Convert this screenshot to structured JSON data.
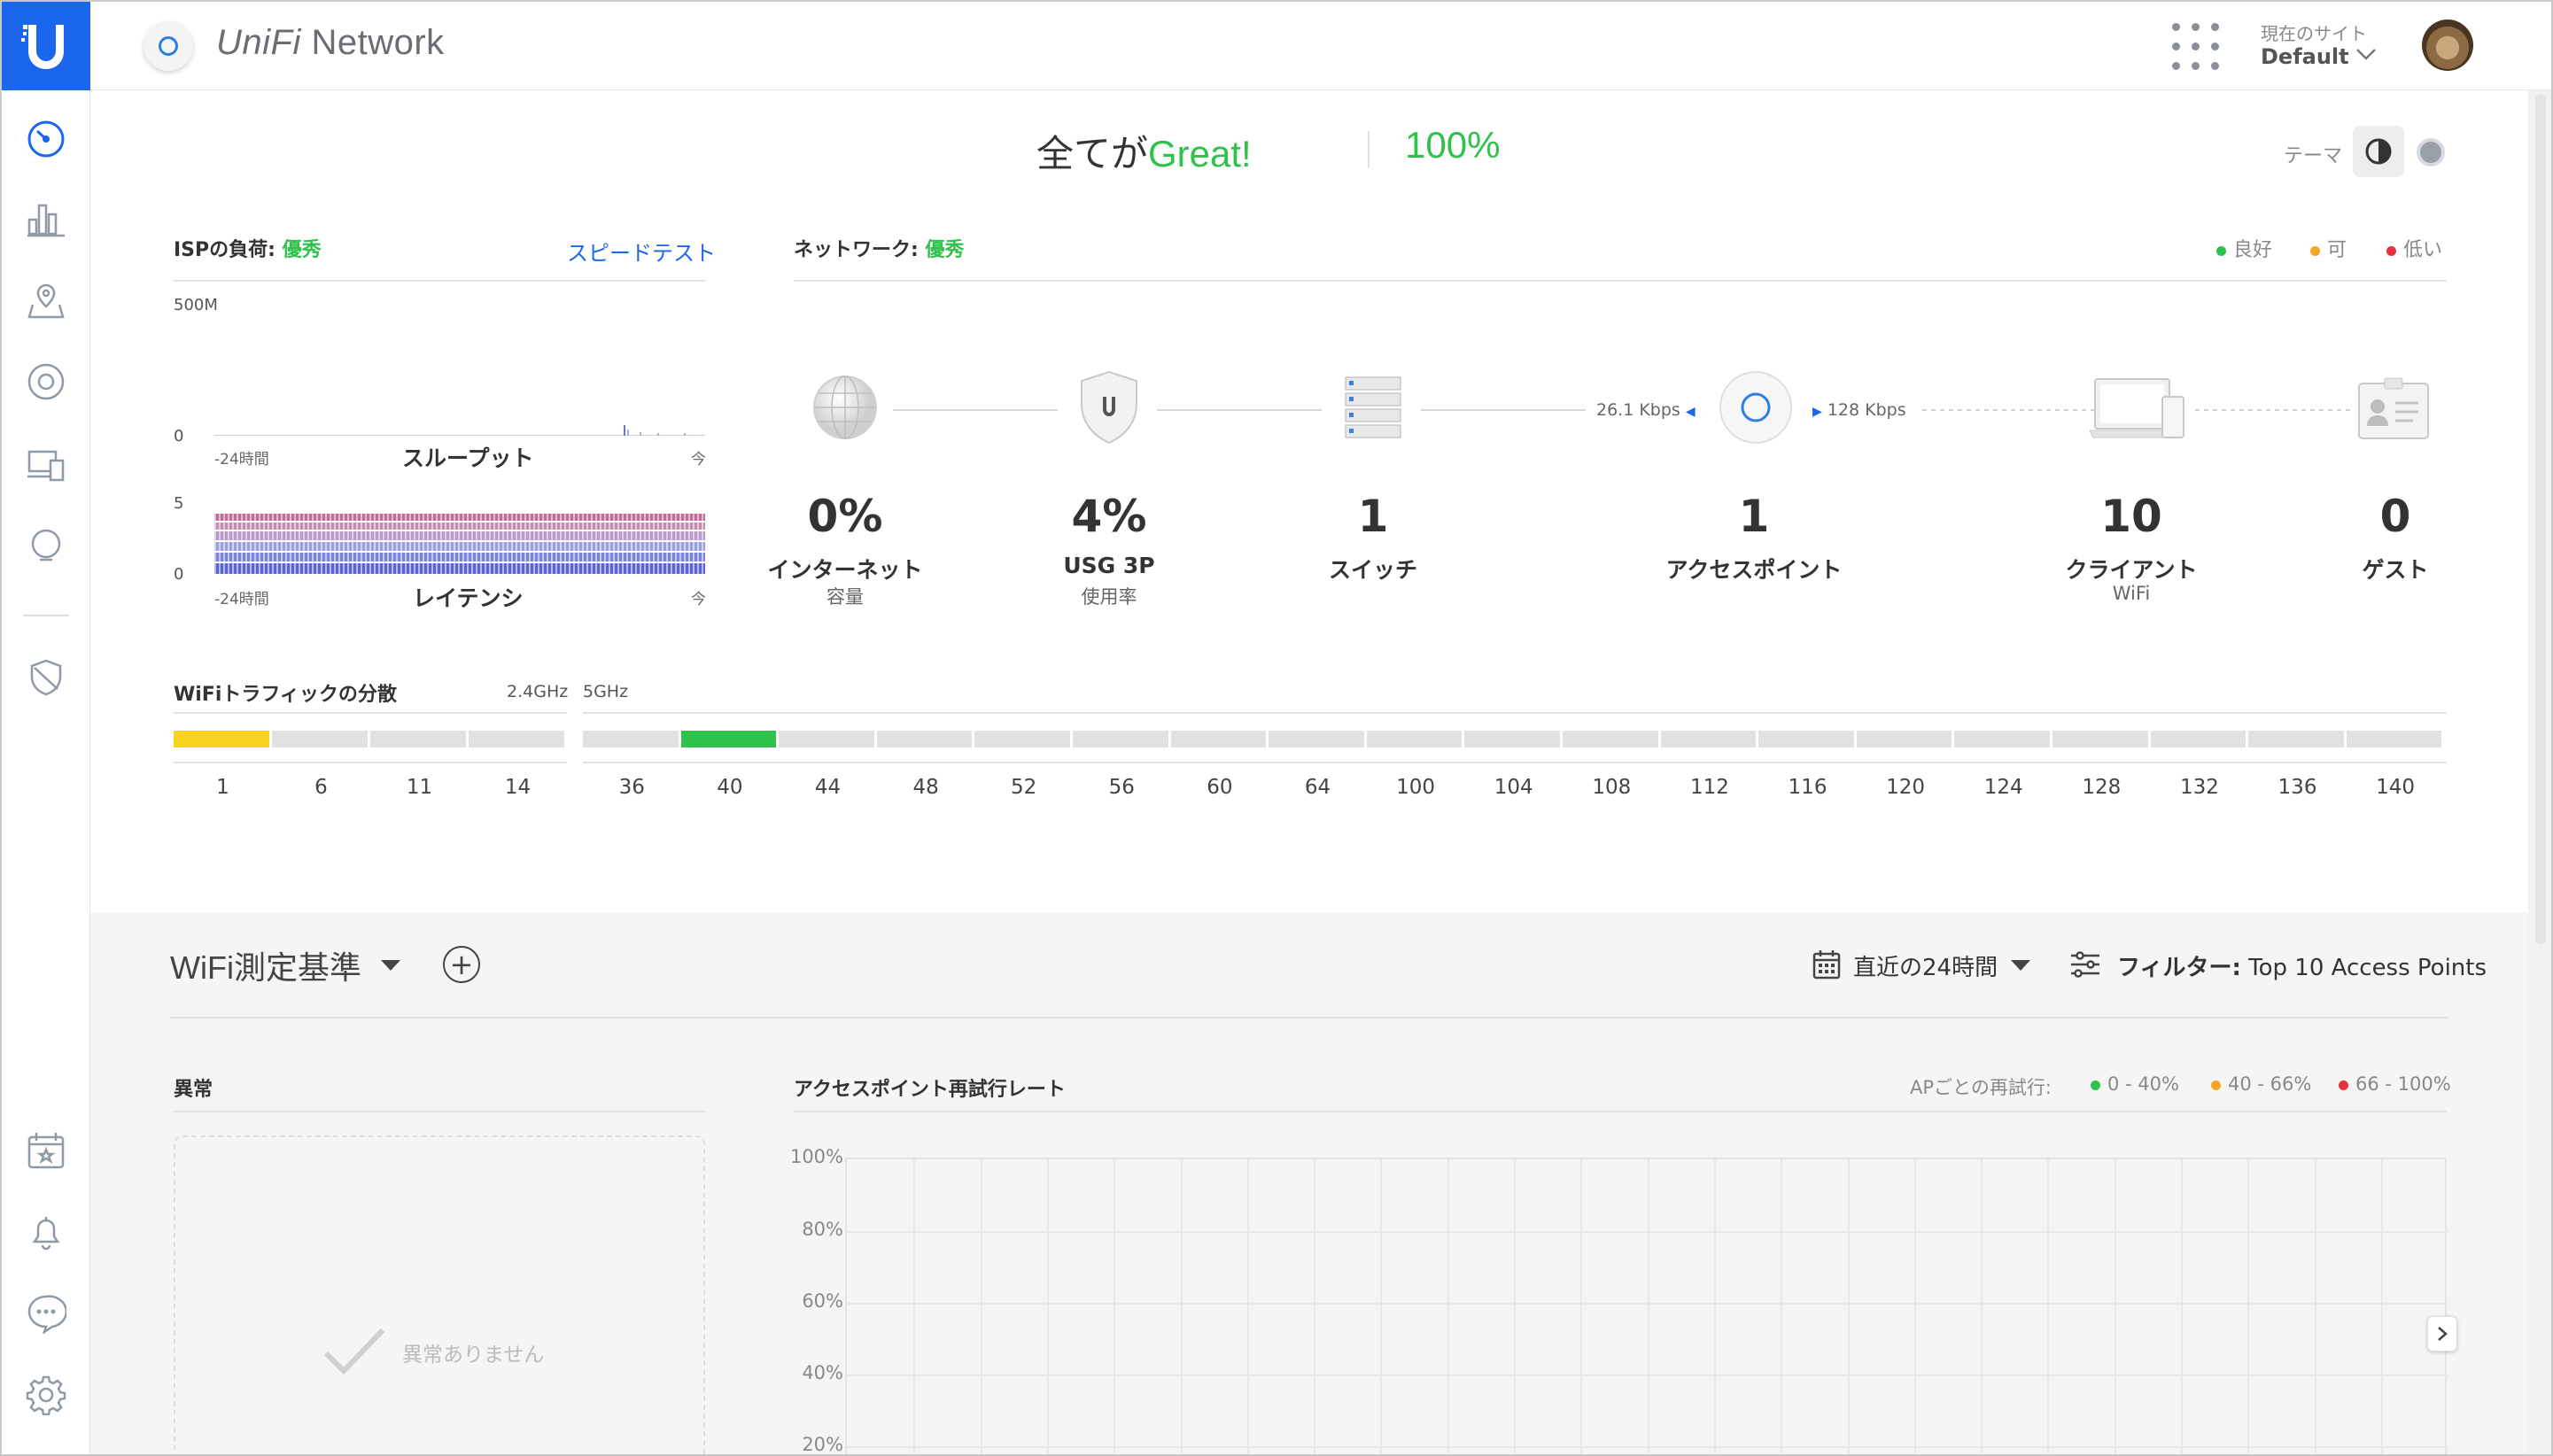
{
  "app": {
    "brand_prefix": "UniFi",
    "brand_suffix": " Network"
  },
  "header": {
    "site_caption": "現在のサイト",
    "site_value": "Default"
  },
  "health": {
    "prefix": "全てが",
    "status": "Great!",
    "percent": "100%",
    "theme_label": "テーマ"
  },
  "isp": {
    "title": "ISPの負荷: ",
    "status": "優秀",
    "speedtest": "スピードテスト",
    "throughput": {
      "ymax": "500M",
      "ymin": "0",
      "start": "-24時間",
      "label": "スループット",
      "end": "今"
    },
    "latency": {
      "ymax": "5",
      "ymin": "0",
      "start": "-24時間",
      "label": "レイテンシ",
      "end": "今"
    }
  },
  "network": {
    "title": "ネットワーク: ",
    "status": "優秀",
    "legend": [
      {
        "label": "良好",
        "color": "#2ec24a"
      },
      {
        "label": "可",
        "color": "#f5a623"
      },
      {
        "label": "低い",
        "color": "#e5323b"
      }
    ],
    "rate_down": "26.1 Kbps",
    "rate_up": "128 Kbps",
    "stats": [
      {
        "value": "0%",
        "label": "インターネット",
        "sub": "容量"
      },
      {
        "value": "4%",
        "label": "USG 3P",
        "sub": "使用率"
      },
      {
        "value": "1",
        "label": "スイッチ",
        "sub": ""
      },
      {
        "value": "1",
        "label": "アクセスポイント",
        "sub": ""
      },
      {
        "value": "10",
        "label": "クライアント",
        "sub": "WiFi"
      },
      {
        "value": "0",
        "label": "ゲスト",
        "sub": ""
      }
    ]
  },
  "wifi_traffic": {
    "title": "WiFiトラフィックの分散",
    "band24": "2.4GHz",
    "band5": "5GHz",
    "channels24": [
      "1",
      "6",
      "11",
      "14"
    ],
    "channels5": [
      "36",
      "40",
      "44",
      "48",
      "52",
      "56",
      "60",
      "64",
      "100",
      "104",
      "108",
      "112",
      "116",
      "120",
      "124",
      "128",
      "132",
      "136",
      "140"
    ],
    "active24_color": "#f7d21e",
    "active5_color": "#2ec24a"
  },
  "metrics": {
    "title": "WiFi測定基準",
    "range": "直近の24時間",
    "filter_label": "フィルター:",
    "filter_value": " Top 10 Access Points",
    "anomalies_title": "異常",
    "anomalies_empty": "異常ありません",
    "retry_title": "アクセスポイント再試行レート",
    "retry_legend_caption": "APごとの再試行:",
    "retry_legend": [
      {
        "label": "0 - 40%",
        "color": "#2ec24a"
      },
      {
        "label": "40 - 66%",
        "color": "#f5a623"
      },
      {
        "label": "66 - 100%",
        "color": "#e5323b"
      }
    ],
    "yticks": [
      "100%",
      "80%",
      "60%",
      "40%",
      "20%"
    ]
  }
}
